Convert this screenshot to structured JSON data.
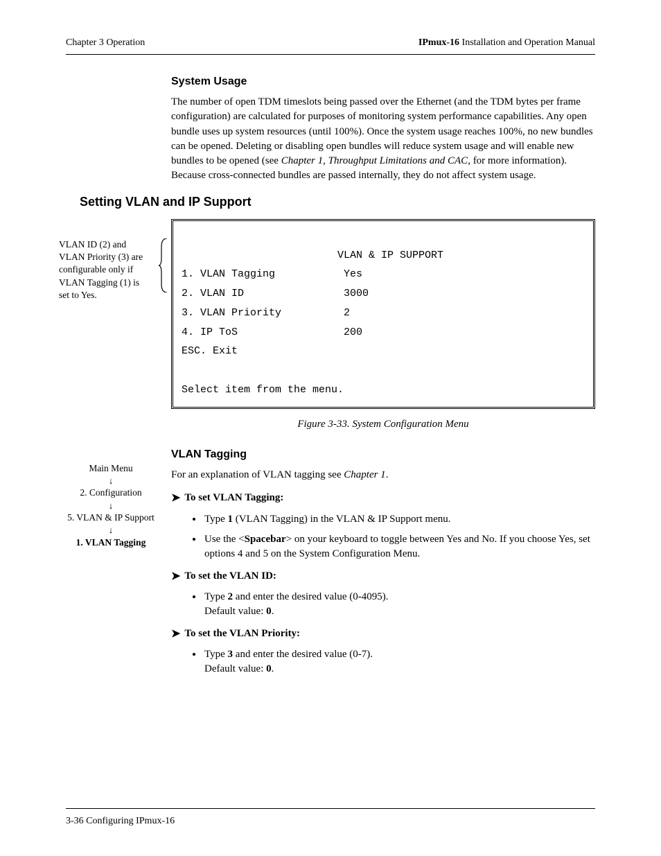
{
  "header": {
    "left": "Chapter 3  Operation",
    "right_bold": "IPmux-16",
    "right_rest": " Installation and Operation Manual"
  },
  "system_usage": {
    "title": "System Usage",
    "para_pre": "The number of open TDM timeslots being passed over the Ethernet (and the TDM bytes per frame configuration) are calculated for purposes of monitoring system performance capabilities. Any open bundle uses up system resources (until 100%). Once the system usage reaches 100%, no new bundles can be opened. Deleting or disabling open bundles will reduce system usage and will enable new bundles to be opened (see ",
    "para_italic": "Chapter 1, Throughput Limitations and CAC",
    "para_post": ", for more information). Because cross-connected bundles are passed internally, they do not affect system usage."
  },
  "section_title": "Setting VLAN and IP Support",
  "side_note": "VLAN ID (2) and VLAN Priority (3) are configurable only if VLAN Tagging (1) is set to Yes.",
  "terminal": {
    "title": "                         VLAN & IP SUPPORT",
    "l1": "1. VLAN Tagging           Yes",
    "l2": "2. VLAN ID                3000",
    "l3": "3. VLAN Priority          2",
    "l4": "4. IP ToS                 200",
    "l5": "ESC. Exit",
    "blank": " ",
    "prompt": "Select item from the menu."
  },
  "figure_caption": "Figure 3-33.  System Configuration Menu",
  "vlan_tagging": {
    "title": "VLAN Tagging",
    "intro_pre": "For an explanation of VLAN tagging see ",
    "intro_italic": "Chapter 1",
    "intro_post": "."
  },
  "nav": {
    "n1": "Main Menu",
    "n2": "2. Configuration",
    "n3": "5. VLAN & IP Support",
    "n4": "1. VLAN Tagging",
    "arrow": "↓"
  },
  "proc1": {
    "head": "To set VLAN Tagging:",
    "b1_pre": "Type ",
    "b1_bold": "1",
    "b1_post": " (VLAN Tagging) in the VLAN & IP Support menu.",
    "b2_pre": "Use the <",
    "b2_bold": "Spacebar",
    "b2_mid": "> on your keyboard to toggle between Yes and No. If you choose Yes, set options 4 and 5 on the System Configuration Menu."
  },
  "proc2": {
    "head": "To set the VLAN ID:",
    "b1_pre": "Type ",
    "b1_bold": "2",
    "b1_mid": " and enter the desired value (0-4095).",
    "b1_def_pre": "Default value: ",
    "b1_def_bold": "0",
    "b1_def_post": "."
  },
  "proc3": {
    "head": "To set the VLAN Priority:",
    "b1_pre": "Type ",
    "b1_bold": "3",
    "b1_mid": " and enter the desired value (0-7).",
    "b1_def_pre": "Default value: ",
    "b1_def_bold": "0",
    "b1_def_post": "."
  },
  "footer": "3-36 Configuring IPmux-16"
}
